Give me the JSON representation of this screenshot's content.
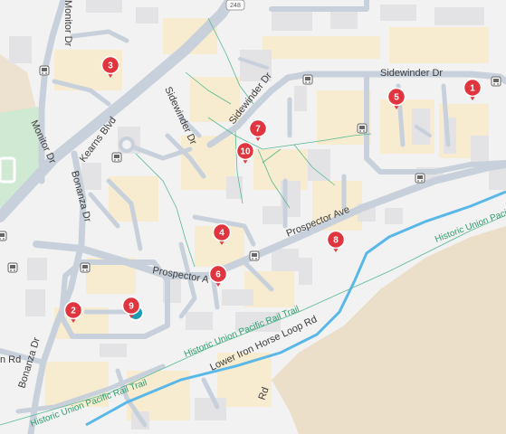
{
  "map": {
    "colors": {
      "background": "#f2f2f2",
      "terrain": "#ecdfc9",
      "park": "#cfe9d3",
      "building": "#e3e3e6",
      "block": "#f7eccf",
      "road": "#c8d1db",
      "road_edge": "#b5bfca",
      "river": "#5ab8e8",
      "trail": "#58b892",
      "pin": "#e0353f"
    },
    "route_shield": "248",
    "street_labels": {
      "sidewinder_east": "Sidewinder Dr",
      "sidewinder_a": "Sidewinder Dr",
      "sidewinder_b": "Sidewinder Dr",
      "kearns": "Kearns Blvd",
      "monitor": "Monitor Dr",
      "bonanza_upper": "Bonanza Dr",
      "bonanza_lower": "Bonanza Dr",
      "prospector_main": "Prospector Ave",
      "prospector_short": "Prospector A",
      "iron_horse_a": "Lower Iron Horse Loop Rd",
      "iron_horse_b": "Rd",
      "n_rd": "n Rd"
    },
    "trail_labels": {
      "rail_trail_east": "Historic Union Pacific",
      "rail_trail_mid": "Historic Union Pacific Rail Trail",
      "rail_trail_west": "Historic Union Pacific Rail Trail"
    },
    "markers": [
      {
        "label": "1"
      },
      {
        "label": "2"
      },
      {
        "label": "3"
      },
      {
        "label": "4"
      },
      {
        "label": "5"
      },
      {
        "label": "6"
      },
      {
        "label": "7"
      },
      {
        "label": "8"
      },
      {
        "label": "9"
      },
      {
        "label": "10"
      }
    ]
  }
}
